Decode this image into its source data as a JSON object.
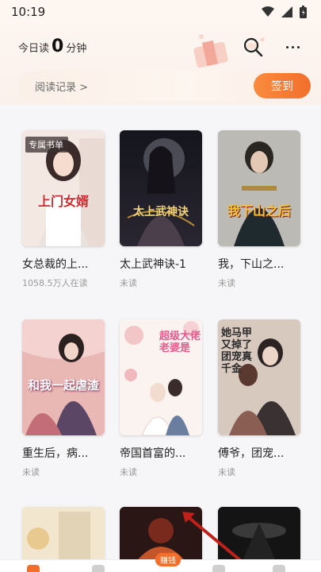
{
  "status_bar": {
    "time": "10:19"
  },
  "header": {
    "read_today_prefix": "今日读",
    "read_today_minutes": "0",
    "read_today_suffix": "分钟",
    "history_label": "阅读记录 >",
    "checkin_label": "签到"
  },
  "books": [
    {
      "title": "女总裁的上...",
      "status": "1058.5万人在读",
      "tag": "专属书单",
      "cover_text": "上门女婿"
    },
    {
      "title": "太上武神诀-1",
      "status": "未读",
      "cover_text": "太上武神诀"
    },
    {
      "title": "我，下山之...",
      "status": "未读",
      "cover_text": "我下山之后"
    },
    {
      "title": "重生后，病...",
      "status": "未读",
      "cover_text": "和我一起虐渣"
    },
    {
      "title": "帝国首富的...",
      "status": "未读",
      "cover_text": "超级大佬老婆是"
    },
    {
      "title": "傅爷，团宠...",
      "status": "未读",
      "cover_text": "她马甲又掉了 团宠真千金"
    }
  ],
  "bottom_nav": {
    "ad_badge": "赚钱"
  },
  "colors": {
    "accent": "#f26f2b",
    "background": "#f6f6f8"
  }
}
